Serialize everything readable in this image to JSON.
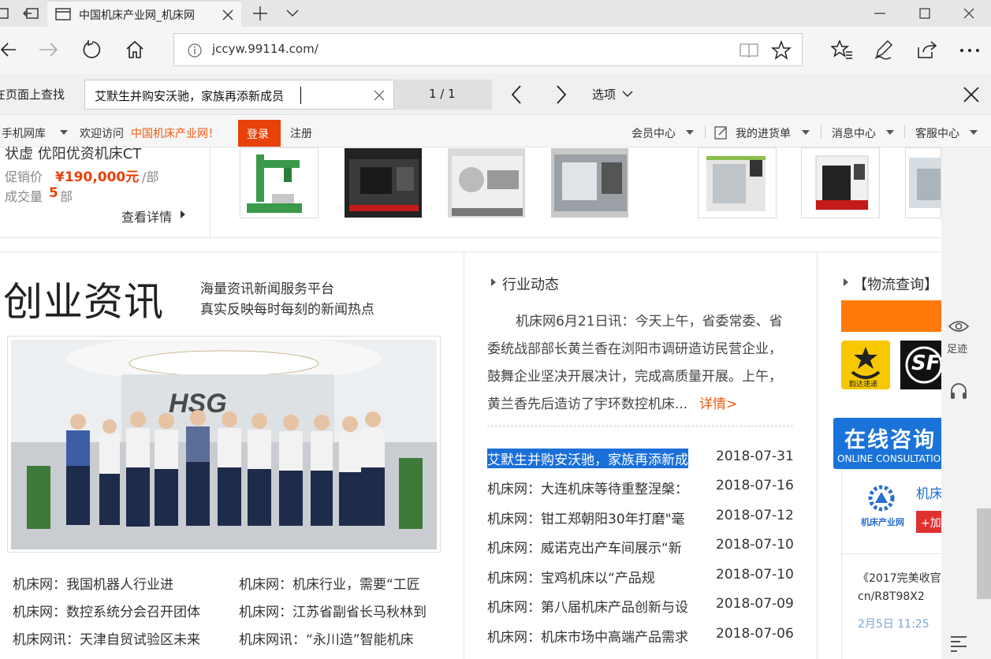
{
  "browser": {
    "tab_title": "中国机床产业网_机床网",
    "url": "jccyw.99114.com/",
    "find_label": "在页面上查找",
    "find_query": "艾默生并购安沃驰，家族再添新成员",
    "find_count": "1 / 1",
    "options_label": "选项"
  },
  "topnav": {
    "mobile": "手机网库",
    "welcome": "欢迎访问",
    "site_name": "中国机床产业网！",
    "login": "登录",
    "register": "注册",
    "member": "会员中心",
    "purchase": "我的进货单",
    "message": "消息中心",
    "service": "客服中心"
  },
  "product": {
    "title_partial": "状虚 优阳优资机床CT",
    "promo_label": "促销价",
    "promo_price": "¥190,000元",
    "promo_unit": "/部",
    "deal_label": "成交量",
    "deal_count": "5",
    "deal_unit": "部",
    "details": "查看详情"
  },
  "section": {
    "title": "创业资讯",
    "sub1": "海量资讯新闻服务平台",
    "sub2": "真实反映每时每刻的新闻热点"
  },
  "industry": {
    "heading": "行业动态",
    "lead": "机床网6月21日讯：今天上午，省委常委、省委统战部部长黄兰香在浏阳市调研造访民营企业，鼓舞企业坚决开展决计，完成高质量开展。上午，黄兰香先后造访了宇环数控机床...",
    "lead_lines": [
      "机床网6月21日讯：今天上午，省委常委、省",
      "委统战部部长黄兰香在浏阳市调研造访民营企业，",
      "鼓舞企业坚决开展决计，完成高质量开展。上午，",
      "黄兰香先后造访了宇环数控机床..."
    ],
    "more": "详情>",
    "news": [
      {
        "title": "艾默生并购安沃驰，家族再添新成",
        "date": "2018-07-31"
      },
      {
        "title": "机床网：大连机床等待重整涅槃：",
        "date": "2018-07-16"
      },
      {
        "title": "机床网：钳工郑朝阳30年打磨\"毫",
        "date": "2018-07-12"
      },
      {
        "title": "机床网：威诺克出产车间展示“新",
        "date": "2018-07-10"
      },
      {
        "title": "机床网：宝鸡机床以“产品规",
        "date": "2018-07-10"
      },
      {
        "title": "机床网：第八届机床产品创新与设",
        "date": "2018-07-09"
      },
      {
        "title": "机床网：机床市场中高端产品需求",
        "date": "2018-07-06"
      }
    ]
  },
  "bottom_news": {
    "left": [
      "机床网：我国机器人行业进",
      "机床网：数控系统分会召开团体",
      "机床网讯：天津自贸试验区未来"
    ],
    "right": [
      "机床网：机床行业，需要“工匠",
      "机床网：江苏省副省长马秋林到",
      "机床网讯：“永川造”智能机床"
    ]
  },
  "logistics": {
    "heading": "【物流查询】",
    "yunda": "韵达速递",
    "sf": "SF"
  },
  "consult": {
    "title": "在线咨询",
    "sub": "ONLINE CONSULTATION"
  },
  "company": {
    "name": "机床",
    "logo_text": "机床产业网",
    "add": "+加"
  },
  "weibo": {
    "text1": "《2017完美收官",
    "text2": "cn/R8T98X2",
    "time": "2月5日 11:25"
  },
  "sidebar": {
    "footprint": "足迹"
  }
}
